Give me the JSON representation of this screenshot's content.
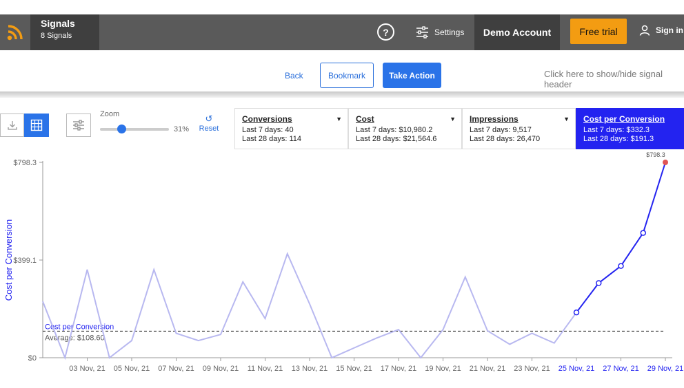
{
  "app": {
    "title": "Signals",
    "subtitle": "8 Signals",
    "help_label": "?",
    "settings_label": "Settings",
    "account_label": "Demo Account",
    "trial_label": "Free trial",
    "signin_label": "Sign in"
  },
  "actions": {
    "back_label": "Back",
    "bookmark_label": "Bookmark",
    "take_action_label": "Take Action",
    "header_toggle_label": "Click here to show/hide signal header"
  },
  "toolbar": {
    "zoom_label": "Zoom",
    "zoom_value": "31%",
    "zoom_fraction": 0.31,
    "reset_label": "Reset"
  },
  "metrics": [
    {
      "name": "Conversions",
      "line1": "Last 7 days: 40",
      "line2": "Last 28 days: 114",
      "active": false
    },
    {
      "name": "Cost",
      "line1": "Last 7 days: $10,980.2",
      "line2": "Last 28 days: $21,564.6",
      "active": false
    },
    {
      "name": "Impressions",
      "line1": "Last 7 days: 9,517",
      "line2": "Last 28 days: 26,470",
      "active": false
    },
    {
      "name": "Cost per Conversion",
      "line1": "Last 7 days: $332.3",
      "line2": "Last 28 days: $191.3",
      "active": true
    }
  ],
  "colors": {
    "accent": "#2a73e8",
    "active_series": "#2323f0",
    "faded_series": "#b8b8f0",
    "highlight_point": "#e05555",
    "trial": "#f39c12"
  },
  "chart_data": {
    "type": "line",
    "ylabel": "Cost per Conversion",
    "ylim": [
      0,
      798.3
    ],
    "y_ticks": [
      "$0",
      "$399.1",
      "$798.3"
    ],
    "x_ticks": [
      "03 Nov, 21",
      "05 Nov, 21",
      "07 Nov, 21",
      "09 Nov, 21",
      "11 Nov, 21",
      "13 Nov, 21",
      "15 Nov, 21",
      "17 Nov, 21",
      "19 Nov, 21",
      "21 Nov, 21",
      "23 Nov, 21",
      "25 Nov, 21",
      "27 Nov, 21",
      "29 Nov, 21"
    ],
    "x_ticks_highlighted": [
      "25 Nov, 21",
      "27 Nov, 21",
      "29 Nov, 21"
    ],
    "average_label": "Cost per Conversion",
    "average_value_label": "Average: $108.60",
    "average": 108.6,
    "peak_label": "$798.3",
    "x": [
      "01 Nov, 21",
      "02 Nov, 21",
      "03 Nov, 21",
      "04 Nov, 21",
      "05 Nov, 21",
      "06 Nov, 21",
      "07 Nov, 21",
      "08 Nov, 21",
      "09 Nov, 21",
      "10 Nov, 21",
      "11 Nov, 21",
      "12 Nov, 21",
      "13 Nov, 21",
      "14 Nov, 21",
      "15 Nov, 21",
      "16 Nov, 21",
      "17 Nov, 21",
      "18 Nov, 21",
      "19 Nov, 21",
      "20 Nov, 21",
      "21 Nov, 21",
      "22 Nov, 21",
      "23 Nov, 21",
      "24 Nov, 21",
      "25 Nov, 21",
      "26 Nov, 21",
      "27 Nov, 21",
      "28 Nov, 21",
      "29 Nov, 21"
    ],
    "series": [
      {
        "values": [
          230,
          0,
          360,
          0,
          70,
          360,
          100,
          70,
          95,
          310,
          160,
          425,
          220,
          0,
          40,
          80,
          115,
          0,
          115,
          330,
          110,
          55,
          100,
          60,
          185,
          305,
          375,
          510,
          798.3
        ]
      }
    ],
    "highlight_start_index": 24
  }
}
